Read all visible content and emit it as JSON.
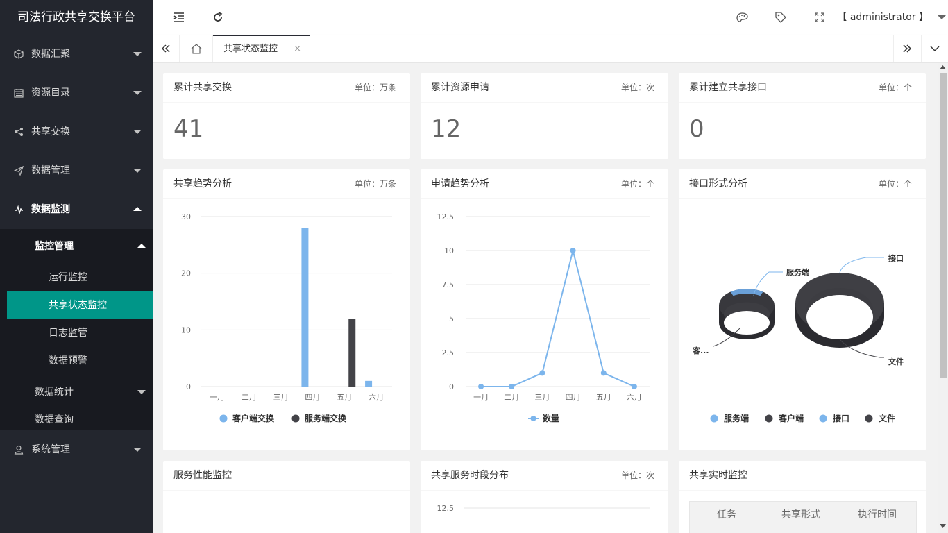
{
  "app": {
    "title": "司法行政共享交换平台"
  },
  "sidebar": {
    "items": [
      {
        "label": "数据汇聚",
        "icon": "cube-icon"
      },
      {
        "label": "资源目录",
        "icon": "calendar-icon"
      },
      {
        "label": "共享交换",
        "icon": "share-icon"
      },
      {
        "label": "数据管理",
        "icon": "send-icon"
      },
      {
        "label": "数据监测",
        "icon": "pulse-icon"
      },
      {
        "label": "系统管理",
        "icon": "user-icon"
      }
    ],
    "sub": {
      "monitor": "监控管理",
      "leaves": [
        "运行监控",
        "共享状态监控",
        "日志监管",
        "数据预警"
      ],
      "stats": "数据统计",
      "query": "数据查询"
    }
  },
  "header": {
    "user": "【 administrator 】"
  },
  "tabs": {
    "active": "共享状态监控",
    "close": "×"
  },
  "cards": {
    "c1": {
      "title": "累计共享交换",
      "unit": "单位：万条",
      "value": "41"
    },
    "c2": {
      "title": "累计资源申请",
      "unit": "单位：次",
      "value": "12"
    },
    "c3": {
      "title": "累计建立共享接口",
      "unit": "单位：个",
      "value": "0"
    },
    "c4": {
      "title": "共享趋势分析",
      "unit": "单位：万条"
    },
    "c5": {
      "title": "申请趋势分析",
      "unit": "单位：个"
    },
    "c6": {
      "title": "接口形式分析",
      "unit": "单位：个"
    },
    "c7": {
      "title": "服务性能监控"
    },
    "c8": {
      "title": "共享服务时段分布",
      "unit": "单位：次"
    },
    "c9": {
      "title": "共享实时监控",
      "columns": [
        "任务",
        "共享形式",
        "执行时间"
      ]
    }
  },
  "chart_data": [
    {
      "type": "bar",
      "categories": [
        "一月",
        "二月",
        "三月",
        "四月",
        "五月",
        "六月"
      ],
      "series": [
        {
          "name": "客户端交换",
          "values": [
            0,
            0,
            0,
            28,
            0,
            1
          ],
          "color": "#7cb5ec"
        },
        {
          "name": "服务端交换",
          "values": [
            0,
            0,
            0,
            0,
            12,
            0
          ],
          "color": "#434348"
        }
      ],
      "ylim": [
        0,
        30
      ],
      "yticks": [
        0,
        10,
        20,
        30
      ],
      "legend": "bottom"
    },
    {
      "type": "line",
      "categories": [
        "一月",
        "二月",
        "三月",
        "四月",
        "五月",
        "六月"
      ],
      "series": [
        {
          "name": "数量",
          "values": [
            0,
            0,
            1,
            10,
            1,
            0
          ],
          "color": "#7cb5ec"
        }
      ],
      "ylim": [
        0,
        12.5
      ],
      "yticks": [
        "0",
        "2.5",
        "5",
        "7.5",
        "10",
        "12.5"
      ],
      "legend": "bottom"
    },
    {
      "type": "pie",
      "rings": [
        {
          "labels": [
            "服务端",
            "客..."
          ],
          "values": [
            1,
            4
          ]
        },
        {
          "labels": [
            "接口",
            "文件"
          ],
          "values": [
            0,
            1
          ]
        }
      ],
      "legend": [
        "服务端",
        "客户端",
        "接口",
        "文件"
      ],
      "legend_colors": [
        "#7cb5ec",
        "#434348",
        "#7cb5ec",
        "#434348"
      ]
    },
    {
      "type": "line",
      "yticks": [
        "12.5"
      ]
    }
  ]
}
